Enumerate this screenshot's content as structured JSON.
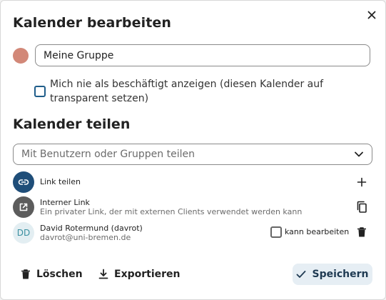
{
  "dialog": {
    "title": "Kalender bearbeiten",
    "close_icon": "close-icon"
  },
  "calendar": {
    "color": "#d28878",
    "name": "Meine Gruppe",
    "transparent_checked": false,
    "transparent_label": "Mich nie als beschäftigt anzeigen (diesen Kalender auf transparent setzen)"
  },
  "sharing": {
    "title": "Kalender teilen",
    "search_placeholder": "Mit Benutzern oder Gruppen teilen",
    "share_link": {
      "label": "Link teilen",
      "icon": "link-icon",
      "action_icon": "plus-icon"
    },
    "internal_link": {
      "title": "Interner Link",
      "description": "Ein privater Link, der mit externen Clients verwendet werden kann",
      "icon": "open-in-new-icon",
      "action_icon": "copy-icon"
    },
    "shares": [
      {
        "initials": "DD",
        "name": "David Rotermund (davrot)",
        "email": "davrot@uni-bremen.de",
        "can_edit_label": "kann bearbeiten",
        "can_edit": false,
        "delete_icon": "trash-icon"
      }
    ]
  },
  "footer": {
    "delete_label": "Löschen",
    "export_label": "Exportieren",
    "save_label": "Speichern"
  }
}
